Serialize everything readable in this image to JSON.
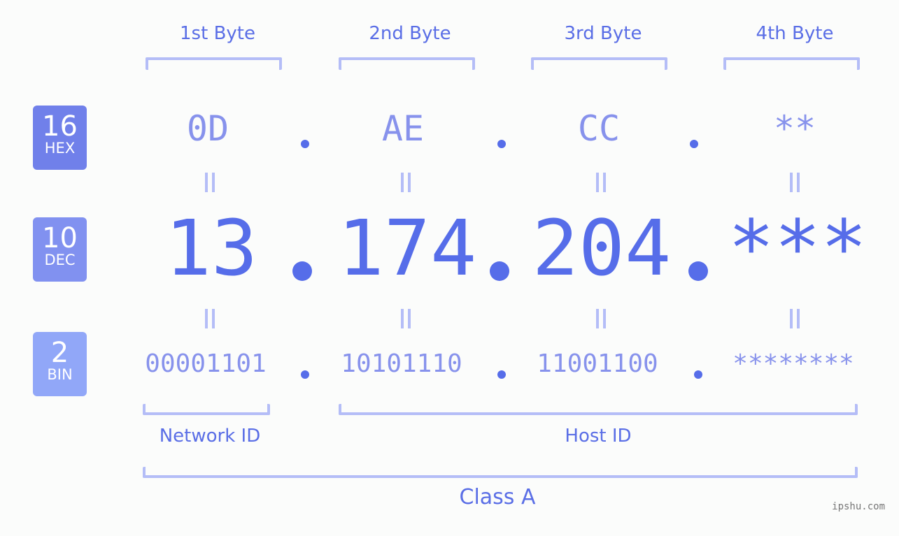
{
  "bytes": [
    {
      "header": "1st Byte",
      "hex": "0D",
      "dec": "13",
      "bin": "00001101"
    },
    {
      "header": "2nd Byte",
      "hex": "AE",
      "dec": "174",
      "bin": "10101110"
    },
    {
      "header": "3rd Byte",
      "hex": "CC",
      "dec": "204",
      "bin": "11001100"
    },
    {
      "header": "4th Byte",
      "hex": "**",
      "dec": "***",
      "bin": "********"
    }
  ],
  "badges": {
    "hex": {
      "base": "16",
      "label": "HEX",
      "color": "#7080ea"
    },
    "dec": {
      "base": "10",
      "label": "DEC",
      "color": "#8191f0"
    },
    "bin": {
      "base": "2",
      "label": "BIN",
      "color": "#91a7f8"
    }
  },
  "groups": {
    "network": "Network ID",
    "host": "Host ID",
    "class": "Class A"
  },
  "watermark": "ipshu.com",
  "colors": {
    "accent": "#566de9",
    "light": "#8792ec",
    "bracket": "#b4bdf7"
  }
}
